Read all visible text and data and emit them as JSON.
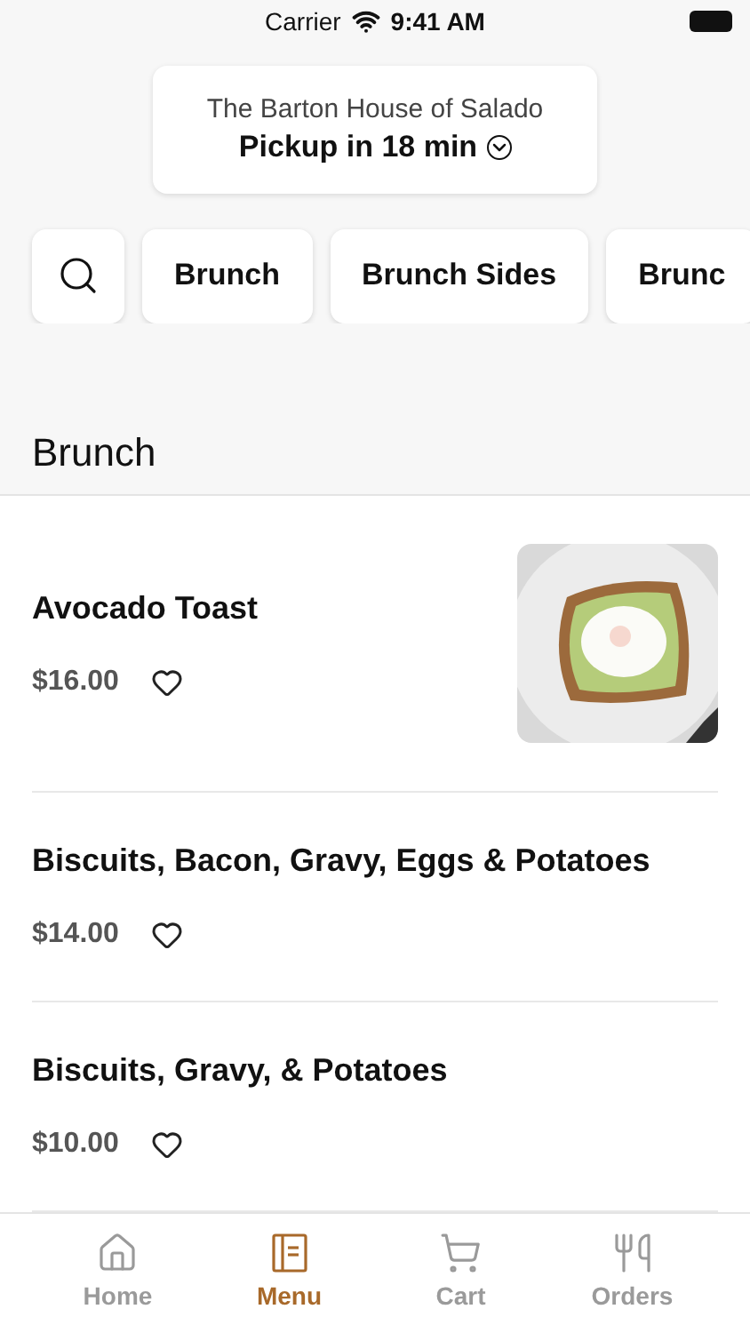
{
  "status_bar": {
    "carrier": "Carrier",
    "time": "9:41 AM"
  },
  "location": {
    "restaurant": "The Barton House of Salado",
    "pickup": "Pickup in 18 min"
  },
  "categories": [
    {
      "label": "Brunch",
      "selected": false
    },
    {
      "label": "Brunch Sides",
      "selected": false
    },
    {
      "label": "Brunc",
      "selected": false
    }
  ],
  "section": {
    "title": "Brunch"
  },
  "items": [
    {
      "name": "Avocado Toast",
      "price": "$16.00"
    },
    {
      "name": "Biscuits, Bacon, Gravy, Eggs & Potatoes",
      "price": "$14.00"
    },
    {
      "name": "Biscuits, Gravy, & Potatoes",
      "price": "$10.00"
    }
  ],
  "tab_bar": [
    {
      "label": "Home",
      "kind": "home",
      "selected": false
    },
    {
      "label": "Menu",
      "kind": "menu",
      "selected": true
    },
    {
      "label": "Cart",
      "kind": "cart",
      "selected": false
    },
    {
      "label": "Orders",
      "kind": "orders",
      "selected": false
    }
  ]
}
